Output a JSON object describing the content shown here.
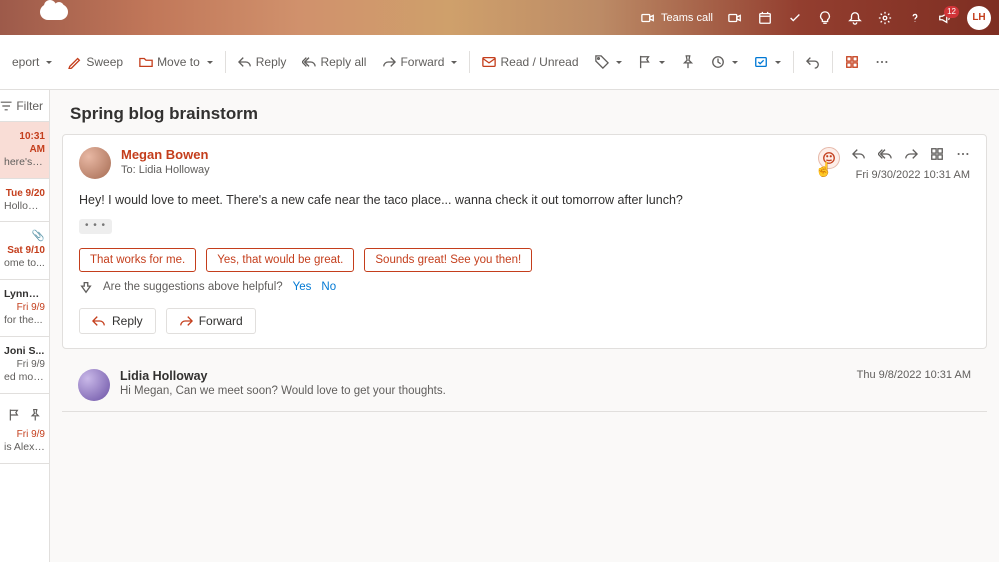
{
  "titlebar": {
    "teams_pill": "Teams call",
    "notif_count": "12",
    "avatar_initials": "LH"
  },
  "ribbon": {
    "report": "eport",
    "sweep": "Sweep",
    "move": "Move to",
    "reply": "Reply",
    "reply_all": "Reply all",
    "forward": "Forward",
    "read_unread": "Read / Unread"
  },
  "filter_label": "Filter",
  "list": [
    {
      "time": "10:31 AM",
      "snip": "here's a ..."
    },
    {
      "time": "Tue 9/20",
      "name": "Holloway..."
    },
    {
      "time": "Sat 9/10",
      "snip": "ome to..."
    },
    {
      "name": "Lynne ...",
      "time": "Fri 9/9",
      "snip": "for the..."
    },
    {
      "name": "Joni S...",
      "time": "Fri 9/9",
      "snip": "ed mov..."
    },
    {
      "time": "Fri 9/9",
      "snip": "is Alex I..."
    }
  ],
  "thread": {
    "subject": "Spring blog brainstorm",
    "msg": {
      "sender": "Megan Bowen",
      "to": "To:  Lidia Holloway",
      "date": "Fri 9/30/2022 10:31 AM",
      "body": "Hey! I would love to meet. There's a new cafe near the taco place... wanna check it out tomorrow after lunch?",
      "suggestions": [
        "That works for me.",
        "Yes, that would be great.",
        "Sounds great! See you then!"
      ],
      "feedback_q": "Are the suggestions above helpful?",
      "fb_yes": "Yes",
      "fb_no": "No",
      "reply_btn": "Reply",
      "forward_btn": "Forward"
    },
    "prev": {
      "sender": "Lidia Holloway",
      "snippet": "Hi Megan, Can we meet soon? Would love to get your thoughts.",
      "date": "Thu 9/8/2022 10:31 AM"
    }
  }
}
